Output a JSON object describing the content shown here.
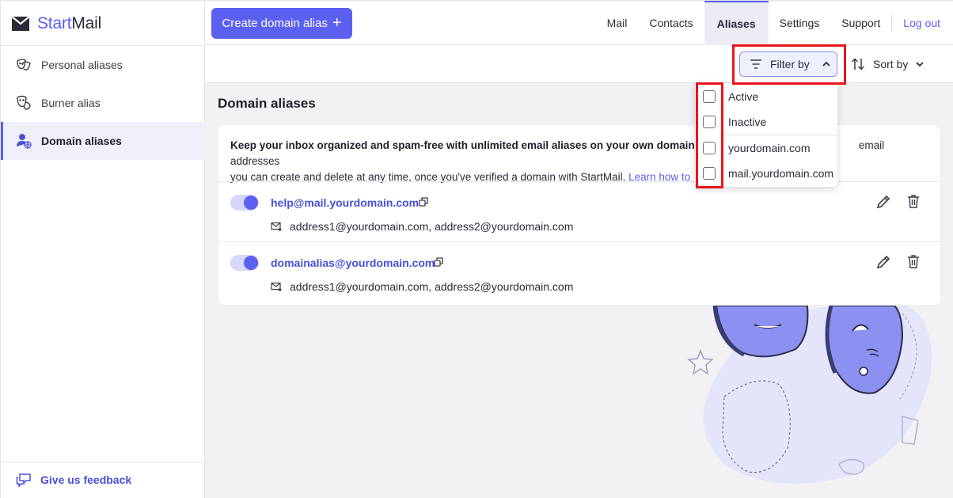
{
  "app": {
    "logo_part1": "Start",
    "logo_part2": "Mail"
  },
  "sidebar": {
    "items": [
      {
        "label": "Personal aliases",
        "icon": "masks-icon"
      },
      {
        "label": "Burner alias",
        "icon": "burner-mask-icon"
      },
      {
        "label": "Domain aliases",
        "icon": "domain-user-icon",
        "active": true
      }
    ],
    "feedback_label": "Give us feedback"
  },
  "topbar": {
    "create_label": "Create domain alias",
    "nav": [
      "Mail",
      "Contacts",
      "Aliases",
      "Settings",
      "Support"
    ],
    "active_nav": "Aliases",
    "logout_label": "Log out"
  },
  "toolbar": {
    "filter_label": "Filter by",
    "sort_label": "Sort by"
  },
  "filter_menu": {
    "status_options": [
      {
        "label": "Active",
        "checked": false
      },
      {
        "label": "Inactive",
        "checked": false
      }
    ],
    "domain_options": [
      {
        "label": "yourdomain.com",
        "checked": false
      },
      {
        "label": "mail.yourdomain.com",
        "checked": false
      }
    ]
  },
  "main": {
    "title": "Domain aliases",
    "intro_bold": "Keep your inbox organized and spam-free with unlimited email aliases on your own domain.",
    "intro_rest_1": " D",
    "intro_tail_line1": "email addresses",
    "intro_line2": "you can create and delete at any time, once you've verified a domain with StartMail.",
    "intro_link": "Learn how to",
    "aliases": [
      {
        "address": "help@mail.yourdomain.com",
        "forwards_to": "address1@yourdomain.com, address2@yourdomain.com",
        "active": true
      },
      {
        "address": "domainalias@yourdomain.com",
        "forwards_to": "address1@yourdomain.com, address2@yourdomain.com",
        "active": true
      }
    ]
  },
  "colors": {
    "accent": "#5b60f0",
    "highlight": "#e8161b",
    "active_bg": "#f0f0fb"
  }
}
